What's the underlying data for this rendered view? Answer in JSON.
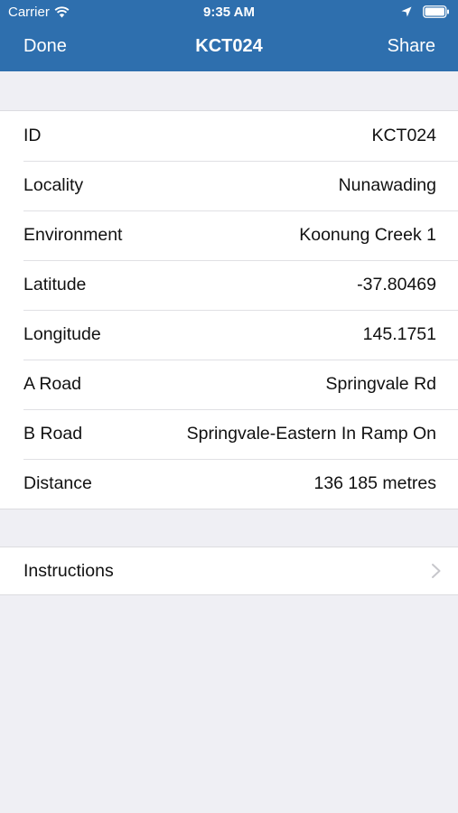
{
  "status_bar": {
    "carrier": "Carrier",
    "time": "9:35 AM"
  },
  "nav": {
    "left_label": "Done",
    "title": "KCT024",
    "right_label": "Share"
  },
  "details": [
    {
      "label": "ID",
      "value": "KCT024"
    },
    {
      "label": "Locality",
      "value": "Nunawading"
    },
    {
      "label": "Environment",
      "value": "Koonung Creek 1"
    },
    {
      "label": "Latitude",
      "value": "-37.80469"
    },
    {
      "label": "Longitude",
      "value": "145.1751"
    },
    {
      "label": "A Road",
      "value": "Springvale Rd"
    },
    {
      "label": "B Road",
      "value": "Springvale-Eastern In Ramp On"
    },
    {
      "label": "Distance",
      "value": "136 185 metres"
    }
  ],
  "instructions": {
    "label": "Instructions"
  },
  "colors": {
    "nav_background": "#2e6fae",
    "page_background": "#efeff4",
    "chevron": "#c7c7cc"
  },
  "icons": [
    "wifi-icon",
    "location-arrow-icon",
    "battery-icon",
    "chevron-right-icon"
  ]
}
